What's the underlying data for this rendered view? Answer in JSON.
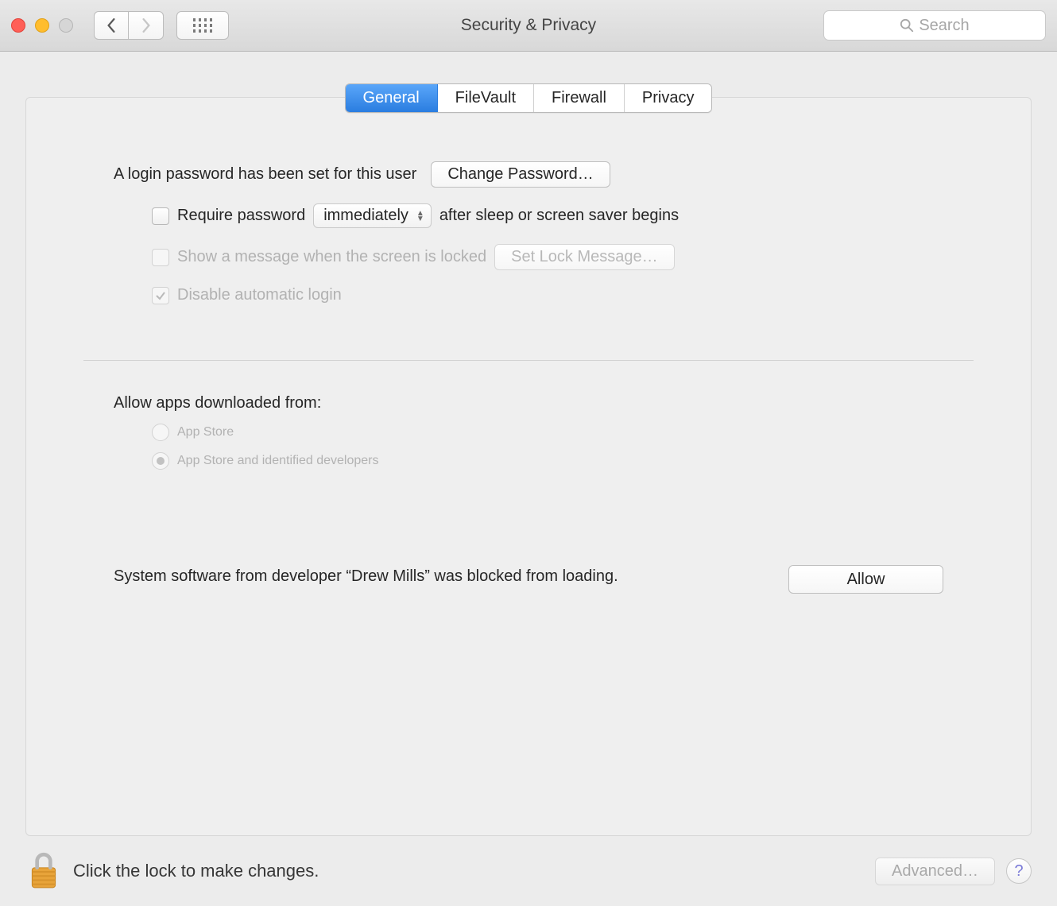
{
  "window": {
    "title": "Security & Privacy"
  },
  "search": {
    "placeholder": "Search"
  },
  "tabs": {
    "general": "General",
    "filevault": "FileVault",
    "firewall": "Firewall",
    "privacy": "Privacy"
  },
  "login_section": {
    "password_set_text": "A login password has been set for this user",
    "change_password_btn": "Change Password…"
  },
  "require_password": {
    "label_prefix": "Require password",
    "select_value": "immediately",
    "label_suffix": "after sleep or screen saver begins"
  },
  "lock_message": {
    "label": "Show a message when the screen is locked",
    "button": "Set Lock Message…"
  },
  "disable_auto_login": {
    "label": "Disable automatic login"
  },
  "allow_apps": {
    "title": "Allow apps downloaded from:",
    "option_app_store": "App Store",
    "option_identified": "App Store and identified developers"
  },
  "blocked_software": {
    "text": "System software from developer “Drew Mills” was blocked from loading.",
    "allow_btn": "Allow"
  },
  "footer": {
    "lock_text": "Click the lock to make changes.",
    "advanced_btn": "Advanced…",
    "help_btn": "?"
  }
}
